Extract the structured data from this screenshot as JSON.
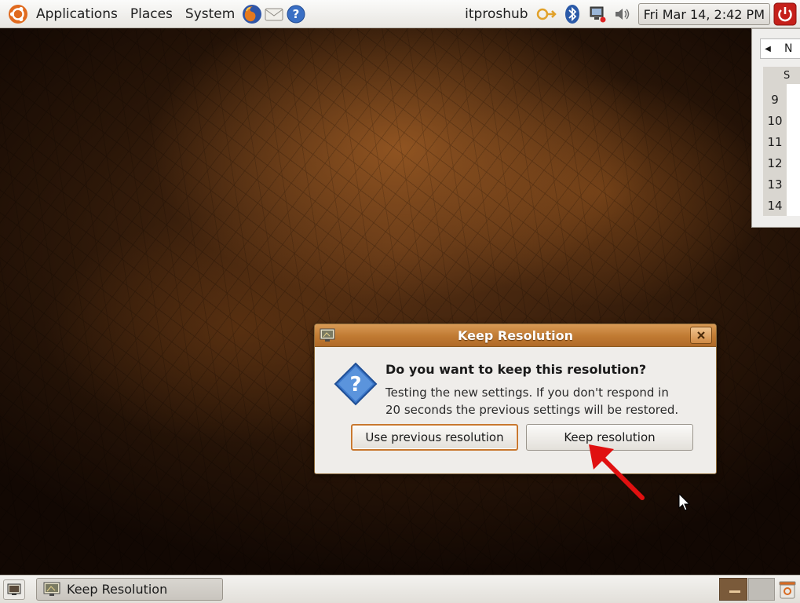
{
  "top_panel": {
    "menus": [
      "Applications",
      "Places",
      "System"
    ],
    "launchers": [
      "firefox-icon",
      "mail-icon",
      "help-icon"
    ],
    "username": "itproshub",
    "clock": "Fri Mar 14,  2:42 PM"
  },
  "calendar": {
    "month_partial": "N",
    "day_header_partial": "S",
    "week_numbers": [
      "9",
      "10",
      "11",
      "12",
      "13",
      "14"
    ]
  },
  "dialog": {
    "title": "Keep Resolution",
    "heading": "Do you want to keep this resolution?",
    "body_line1": "Testing the new settings. If you don't respond in",
    "body_line2": "20 seconds the previous settings will be restored.",
    "btn_previous": "Use previous resolution",
    "btn_keep": "Keep resolution"
  },
  "bottom_panel": {
    "task_label": "Keep Resolution"
  },
  "colors": {
    "titlebar": "#c07a32",
    "arrow": "#e01010",
    "focus_border": "#c8782f"
  }
}
